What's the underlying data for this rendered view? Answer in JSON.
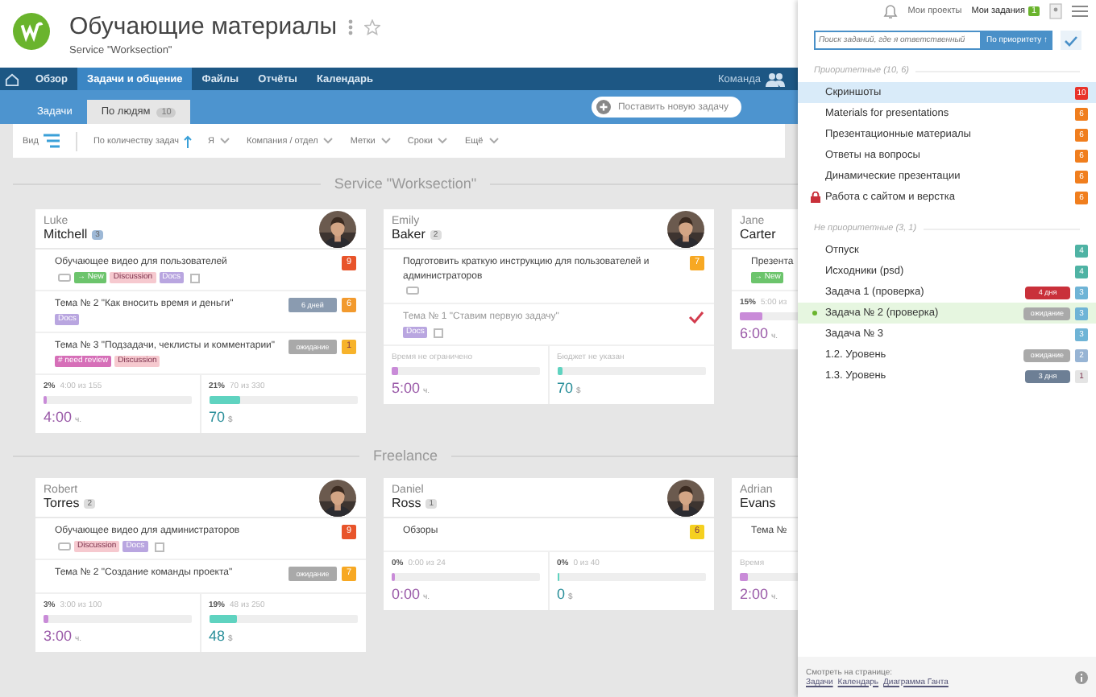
{
  "project": {
    "title": "Обучающие материалы",
    "subtitle": "Service \"Worksection\""
  },
  "nav": {
    "items": [
      {
        "label": "Обзор",
        "selected": false
      },
      {
        "label": "Задачи и общение",
        "selected": true
      },
      {
        "label": "Файлы",
        "selected": false
      },
      {
        "label": "Отчёты",
        "selected": false
      },
      {
        "label": "Календарь",
        "selected": false
      }
    ],
    "team": "Команда"
  },
  "subnav": {
    "tabs": [
      {
        "label": "Задачи",
        "selected": false
      },
      {
        "label": "По людям",
        "count": "10",
        "selected": true
      }
    ],
    "new_task": "Поставить новую задачу"
  },
  "filters": [
    {
      "label": "Вид",
      "kind": "view"
    },
    {
      "label": "По количеству задач",
      "kind": "sort"
    },
    {
      "label": "Я",
      "kind": "dropdown"
    },
    {
      "label": "Компания / отдел",
      "kind": "dropdown"
    },
    {
      "label": "Метки",
      "kind": "dropdown"
    },
    {
      "label": "Сроки",
      "kind": "dropdown"
    },
    {
      "label": "Ещё",
      "kind": "dropdown"
    }
  ],
  "sections": [
    {
      "title": "Service \"Worksection\"",
      "cards": [
        {
          "first": "Luke",
          "last": "Mitchell",
          "count": "3",
          "color": "#9db8d6",
          "avatar": true,
          "tasks": [
            {
              "text": "Обучающее видео для пользователей",
              "comments": true,
              "attachment": true,
              "done": false,
              "tags": [
                {
                  "text": "→ New",
                  "color": "#6cc46c"
                },
                {
                  "text": "Discussion",
                  "color": "#f6c9cf"
                },
                {
                  "text": "Docs",
                  "color": "#b9a6e0"
                }
              ],
              "badges": [
                {
                  "text": "9",
                  "color": "#e8542a"
                }
              ]
            },
            {
              "text": "Тема № 2 \"Как вносить время и деньги\"",
              "done": false,
              "tags": [
                {
                  "text": "Docs",
                  "color": "#b9a6e0"
                }
              ],
              "badges": [
                {
                  "text": "6 дней",
                  "color": "#8a9bb0"
                },
                {
                  "text": "6",
                  "color": "#f29a2e"
                }
              ]
            },
            {
              "text": "Тема № 3 \"Подзадачи, чеклисты и комментарии\"",
              "done": false,
              "tags": [
                {
                  "text": "# need review",
                  "color": "#d66fb8"
                },
                {
                  "text": "Discussion",
                  "color": "#f6c9cf"
                }
              ],
              "badges": [
                {
                  "text": "ожидание",
                  "color": "#a9a9a9"
                },
                {
                  "text": "1",
                  "color": "#f7b32b"
                }
              ]
            }
          ],
          "stats": [
            {
              "kind": "time",
              "percent": "2%",
              "text": "4:00 из 155",
              "level": 0.02,
              "value": "4:00",
              "unit": "ч."
            },
            {
              "kind": "money",
              "percent": "21%",
              "text": "70 из 330",
              "level": 0.21,
              "value": "70",
              "unit": "$"
            }
          ]
        },
        {
          "first": "Emily",
          "last": "Baker",
          "count": "2",
          "color": "#dddddd",
          "avatar": true,
          "tasks": [
            {
              "text": "Подготовить краткую инструкцию для пользователей и администраторов",
              "comments": true,
              "done": false,
              "badges": [
                {
                  "text": "7",
                  "color": "#f7a823"
                }
              ]
            },
            {
              "text": "Тема № 1 \"Ставим первую задачу\"",
              "attachment": true,
              "done": true,
              "tags": [
                {
                  "text": "Docs",
                  "color": "#b9a6e0"
                }
              ]
            }
          ],
          "stats": [
            {
              "kind": "time",
              "text": "Время не ограничено",
              "level": 0.04,
              "value": "5:00",
              "unit": "ч."
            },
            {
              "kind": "money",
              "text": "Бюджет не указан",
              "level": 0.04,
              "value": "70",
              "unit": "$"
            }
          ]
        },
        {
          "first": "Jane",
          "last": "Carter",
          "tasks": [
            {
              "text": "Презента",
              "done": false,
              "tags": [
                {
                  "text": "→ New",
                  "color": "#6cc46c"
                }
              ]
            }
          ],
          "stats": [
            {
              "kind": "time",
              "percent": "15%",
              "text": "5:00 из",
              "level": 0.15,
              "value": "6:00",
              "unit": "ч."
            }
          ]
        }
      ]
    },
    {
      "title": "Freelance",
      "cards": [
        {
          "first": "Robert",
          "last": "Torres",
          "count": "2",
          "color": "#dddddd",
          "avatar": true,
          "tasks": [
            {
              "text": "Обучающее видео для администраторов",
              "comments": true,
              "attachment": true,
              "done": false,
              "tags": [
                {
                  "text": "Discussion",
                  "color": "#f6c9cf"
                },
                {
                  "text": "Docs",
                  "color": "#b9a6e0"
                }
              ],
              "badges": [
                {
                  "text": "9",
                  "color": "#e8542a"
                }
              ]
            },
            {
              "text": "Тема № 2 \"Создание команды проекта\"",
              "done": false,
              "badges": [
                {
                  "text": "ожидание",
                  "color": "#a9a9a9"
                },
                {
                  "text": "7",
                  "color": "#f7a823"
                }
              ]
            }
          ],
          "stats": [
            {
              "kind": "time",
              "percent": "3%",
              "text": "3:00 из 100",
              "level": 0.03,
              "value": "3:00",
              "unit": "ч."
            },
            {
              "kind": "money",
              "percent": "19%",
              "text": "48 из 250",
              "level": 0.19,
              "value": "48",
              "unit": "$"
            }
          ]
        },
        {
          "first": "Daniel",
          "last": "Ross",
          "count": "1",
          "color": "#dddddd",
          "avatar": true,
          "tasks": [
            {
              "text": "Обзоры",
              "done": false,
              "badges": [
                {
                  "text": "6",
                  "color": "#f5d020"
                }
              ]
            }
          ],
          "stats": [
            {
              "kind": "time",
              "percent": "0%",
              "text": "0:00 из 24",
              "level": 0,
              "value": "0:00",
              "unit": "ч."
            },
            {
              "kind": "money",
              "percent": "0%",
              "text": "0 из 40",
              "level": 0,
              "value": "0",
              "unit": "$"
            }
          ]
        },
        {
          "first": "Adrian",
          "last": "Evans",
          "tasks": [
            {
              "text": "Тема №",
              "done": false
            }
          ],
          "stats": [
            {
              "kind": "time",
              "text": "Время",
              "level": 0.05,
              "value": "2:00",
              "unit": "ч."
            }
          ]
        }
      ]
    }
  ],
  "panel": {
    "my_projects": "Мои проекты",
    "my_tasks": "Мои задания",
    "my_tasks_count": "1",
    "search": {
      "placeholder": "Поиск заданий, где я ответственный",
      "sort": "По приоритету ↑"
    },
    "groups": [
      {
        "title": "Приоритетные (10, 6)",
        "items": [
          {
            "label": "Скриншоты",
            "selected": true,
            "active": false,
            "locked": false,
            "badges": [
              {
                "text": "10",
                "color": "#e8332a"
              }
            ]
          },
          {
            "label": "Materials for presentations",
            "selected": false,
            "active": false,
            "locked": false,
            "badges": [
              {
                "text": "6",
                "color": "#f07e1e"
              }
            ]
          },
          {
            "label": "Презентационные материалы",
            "selected": false,
            "active": false,
            "locked": false,
            "badges": [
              {
                "text": "6",
                "color": "#f07e1e"
              }
            ]
          },
          {
            "label": "Ответы на вопросы",
            "selected": false,
            "active": false,
            "locked": false,
            "badges": [
              {
                "text": "6",
                "color": "#f07e1e"
              }
            ]
          },
          {
            "label": "Динамические презентации",
            "selected": false,
            "active": false,
            "locked": false,
            "badges": [
              {
                "text": "6",
                "color": "#f07e1e"
              }
            ]
          },
          {
            "label": "Работа с сайтом и верстка",
            "selected": false,
            "active": false,
            "locked": true,
            "badges": [
              {
                "text": "6",
                "color": "#f07e1e"
              }
            ]
          }
        ]
      },
      {
        "title": "Не приоритетные (3, 1)",
        "items": [
          {
            "label": "Отпуск",
            "selected": false,
            "active": false,
            "locked": false,
            "badges": [
              {
                "text": "4",
                "color": "#4fb3a4"
              }
            ]
          },
          {
            "label": "Исходники (psd)",
            "selected": false,
            "active": false,
            "locked": false,
            "badges": [
              {
                "text": "4",
                "color": "#4fb3a4"
              }
            ]
          },
          {
            "label": "Задача 1 (проверка)",
            "selected": false,
            "active": false,
            "locked": false,
            "badges": [
              {
                "text": "4 дня",
                "color": "#c9303a"
              },
              {
                "text": "3",
                "color": "#6fb4d6"
              }
            ]
          },
          {
            "label": "Задача № 2 (проверка)",
            "selected": true,
            "active": true,
            "locked": false,
            "badges": [
              {
                "text": "ожидание",
                "color": "#a9a9a9"
              },
              {
                "text": "3",
                "color": "#6fb4d6"
              }
            ]
          },
          {
            "label": "Задача № 3",
            "selected": false,
            "active": false,
            "locked": false,
            "badges": [
              {
                "text": "3",
                "color": "#6fb4d6"
              }
            ]
          },
          {
            "label": "1.2. Уровень",
            "selected": false,
            "active": false,
            "locked": false,
            "badges": [
              {
                "text": "ожидание",
                "color": "#a9a9a9"
              },
              {
                "text": "2",
                "color": "#97b4d4"
              }
            ]
          },
          {
            "label": "1.3. Уровень",
            "selected": false,
            "active": false,
            "locked": false,
            "badges": [
              {
                "text": "3 дня",
                "color": "#6d7f95"
              },
              {
                "text": "1",
                "color": "#e4e4e4"
              }
            ]
          }
        ]
      }
    ],
    "footer": {
      "label": "Смотреть на странице:",
      "links": [
        "Задачи",
        "Календарь",
        "Диаграмма Ганта"
      ]
    }
  }
}
